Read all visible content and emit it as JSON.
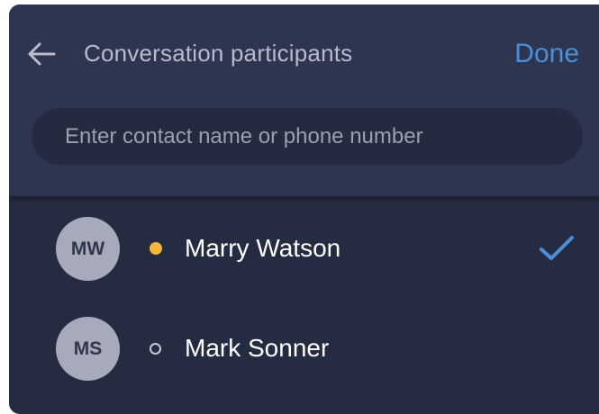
{
  "header": {
    "title": "Conversation participants",
    "done_label": "Done"
  },
  "search": {
    "placeholder": "Enter contact name or phone number",
    "value": ""
  },
  "participants": [
    {
      "initials": "MW",
      "name": "Marry Watson",
      "status": "online",
      "selected": true
    },
    {
      "initials": "MS",
      "name": "Mark Sonner",
      "status": "offline",
      "selected": false
    }
  ],
  "colors": {
    "accent": "#4a8fd8",
    "online_status": "#f3b43a",
    "background": "#252b40",
    "header": "#2e3550"
  },
  "icons": {
    "back": "arrow-left-icon",
    "selected": "checkmark-icon"
  }
}
